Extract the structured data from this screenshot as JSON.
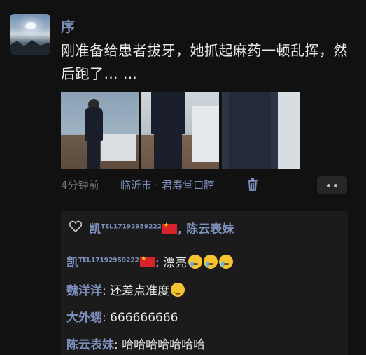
{
  "post": {
    "author": "序",
    "text": "刚准备给患者拔牙，她抓起麻药一顿乱挥，然后跑了… …",
    "time": "4分钟前",
    "location": "临沂市 · 君寿堂口腔",
    "photos": [
      "photo-1",
      "photo-2",
      "photo-3"
    ]
  },
  "likes": {
    "label": "凯TEL17192959222🇨🇳, 陈云表妹",
    "user1_name": "凯",
    "user1_tel": "TEL17192959222",
    "separator": ", ",
    "user2_name": "陈云表妹"
  },
  "comments": [
    {
      "author": "凯",
      "tel": "TEL17192959222",
      "sep": ": ",
      "text": "漂亮",
      "emoji": "cry-laugh x3"
    },
    {
      "author": "魏洋洋",
      "sep": ": ",
      "text": "还差点准度",
      "emoji": "smirk"
    },
    {
      "author": "大外甥",
      "sep": ": ",
      "text": "666666666"
    },
    {
      "author": "陈云表妹",
      "sep": ": ",
      "text": "哈哈哈哈哈哈哈"
    }
  ],
  "colors": {
    "background": "#111111",
    "name_blue": "#7d90bd",
    "comment_bg": "#1b1b1b",
    "meta_gray": "#787878"
  }
}
